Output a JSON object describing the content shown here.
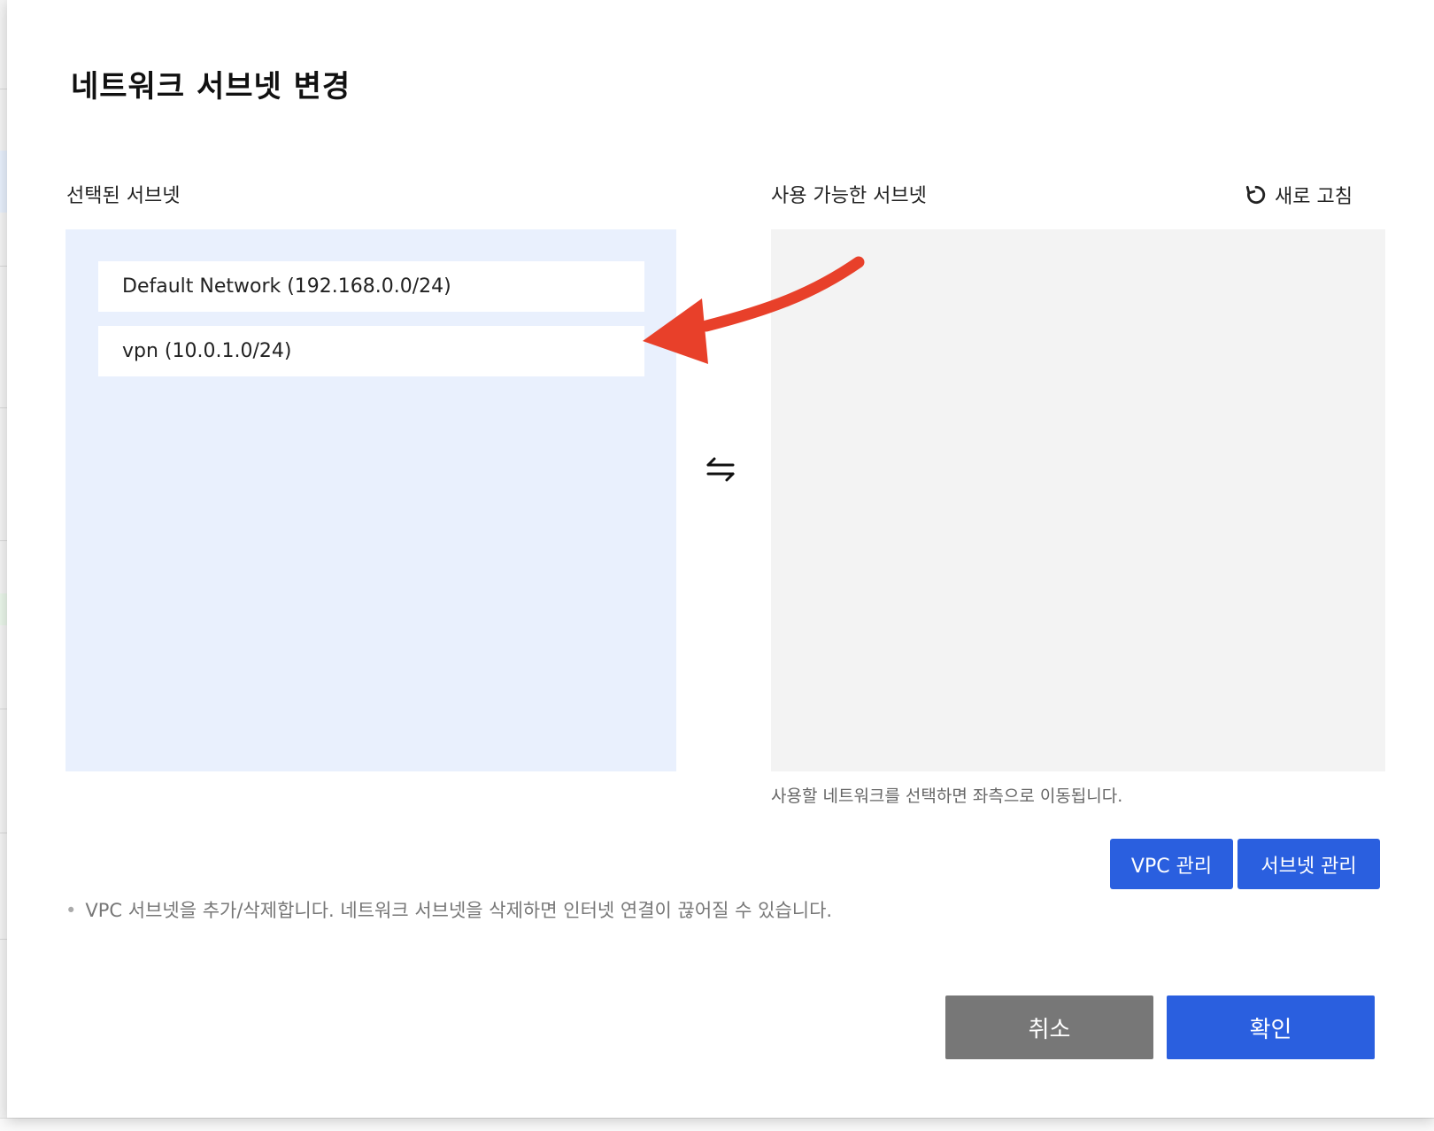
{
  "dialog": {
    "title": "네트워크 서브넷 변경"
  },
  "selected": {
    "label": "선택된 서브넷",
    "items": [
      {
        "label": "Default Network (192.168.0.0/24)"
      },
      {
        "label": "vpn (10.0.1.0/24)"
      }
    ]
  },
  "available": {
    "label": "사용 가능한 서브넷",
    "refresh_label": "새로 고침",
    "hint": "사용할 네트워크를 선택하면 좌측으로 이동됩니다."
  },
  "buttons": {
    "vpc_manage": "VPC 관리",
    "subnet_manage": "서브넷 관리",
    "cancel": "취소",
    "confirm": "확인"
  },
  "note": "VPC 서브넷을 추가/삭제합니다. 네트워크 서브넷을 삭제하면 인터넷 연결이 끊어질 수 있습니다.",
  "colors": {
    "primary": "#2a5fdf",
    "cancel": "#777777",
    "selected_panel": "#e9f0fd",
    "available_panel": "#f3f3f3",
    "annotation_arrow": "#e8402a"
  },
  "icons": {
    "refresh": "refresh-icon",
    "swap": "swap-arrows-icon",
    "annotation": "red-arrow-annotation"
  }
}
